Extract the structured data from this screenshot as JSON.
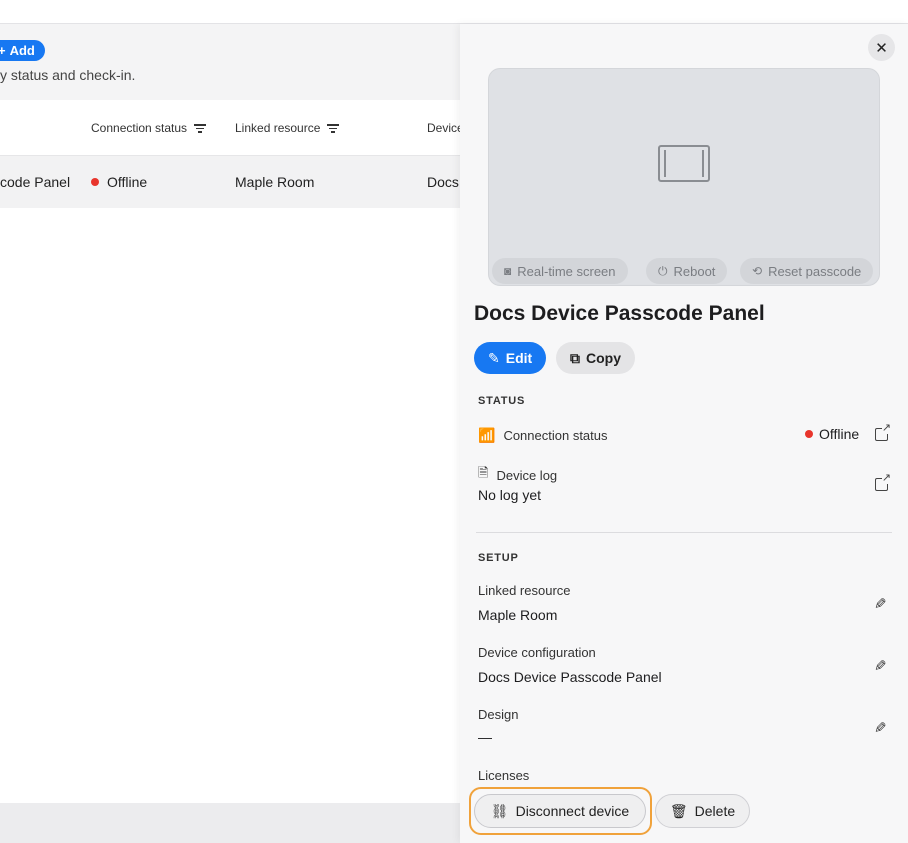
{
  "background": {
    "add_label": "Add",
    "subtitle": "y status and check-in.",
    "columns": [
      "Connection status",
      "Linked resource",
      "Device"
    ],
    "row": {
      "name": "code Panel",
      "status": "Offline",
      "linked_resource": "Maple Room",
      "device": "Docs"
    }
  },
  "panel": {
    "preview_buttons": {
      "realtime": "Real-time screen",
      "reboot": "Reboot",
      "reset": "Reset passcode"
    },
    "title": "Docs Device Passcode Panel",
    "edit_label": "Edit",
    "copy_label": "Copy",
    "status_section": "STATUS",
    "connection_status_label": "Connection status",
    "connection_status_value": "Offline",
    "device_log_label": "Device log",
    "device_log_value": "No log yet",
    "setup_section": "SETUP",
    "linked_resource_label": "Linked resource",
    "linked_resource_value": "Maple Room",
    "device_config_label": "Device configuration",
    "device_config_value": "Docs Device Passcode Panel",
    "design_label": "Design",
    "design_value": "—",
    "licenses_label": "Licenses",
    "disconnect_label": "Disconnect device",
    "delete_label": "Delete"
  },
  "colors": {
    "accent": "#1778f2",
    "offline": "#e8352c",
    "focus_ring": "#f0a23b"
  }
}
